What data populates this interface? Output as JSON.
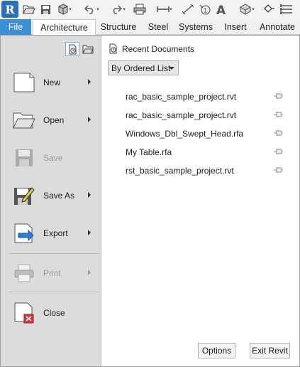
{
  "qat": {
    "app_letter": "R",
    "icons": [
      "app-icon",
      "open-icon",
      "save-icon",
      "sync-icon",
      "undo-icon",
      "redo-icon",
      "print-icon",
      "measure-icon",
      "dimension-icon",
      "tag-icon",
      "text-icon",
      "3d-view-icon",
      "section-icon",
      "switch-windows-icon"
    ]
  },
  "tabs": [
    {
      "label": "File"
    },
    {
      "label": "Architecture"
    },
    {
      "label": "Structure"
    },
    {
      "label": "Steel"
    },
    {
      "label": "Systems"
    },
    {
      "label": "Insert"
    },
    {
      "label": "Annotate"
    }
  ],
  "menu": {
    "items": [
      {
        "label": "New",
        "enabled": true,
        "submenu": true
      },
      {
        "label": "Open",
        "enabled": true,
        "submenu": true
      },
      {
        "label": "Save",
        "enabled": false,
        "submenu": false
      },
      {
        "label": "Save As",
        "enabled": true,
        "submenu": true
      },
      {
        "label": "Export",
        "enabled": true,
        "submenu": true
      },
      {
        "label": "Print",
        "enabled": false,
        "submenu": true
      },
      {
        "label": "Close",
        "enabled": true,
        "submenu": false
      }
    ]
  },
  "recent": {
    "title": "Recent Documents",
    "sort": "By Ordered List",
    "documents": [
      "rac_basic_sample_project.rvt",
      "rac_basic_sample_project.rvt",
      "Windows_Dbl_Swept_Head.rfa",
      "My Table.rfa",
      "rst_basic_sample_project.rvt"
    ]
  },
  "footer": {
    "options_label": "Options",
    "exit_label": "Exit Revit"
  },
  "colors": {
    "file_tab": "#3d8fd6",
    "app_button": "#2a6fb8",
    "left_pane": "#dcdcdc"
  }
}
